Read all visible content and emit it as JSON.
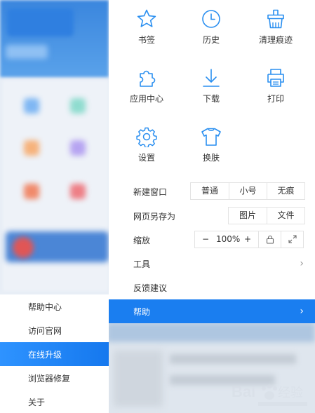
{
  "menu": {
    "icons": [
      {
        "label": "书签",
        "icon": "star-icon"
      },
      {
        "label": "历史",
        "icon": "clock-icon"
      },
      {
        "label": "清理痕迹",
        "icon": "broom-icon"
      },
      {
        "label": "应用中心",
        "icon": "puzzle-icon"
      },
      {
        "label": "下载",
        "icon": "download-icon"
      },
      {
        "label": "打印",
        "icon": "printer-icon"
      },
      {
        "label": "设置",
        "icon": "gear-icon"
      },
      {
        "label": "换肤",
        "icon": "tshirt-icon"
      }
    ],
    "new_window": {
      "label": "新建窗口",
      "options": [
        "普通",
        "小号",
        "无痕"
      ]
    },
    "save_as": {
      "label": "网页另存为",
      "options": [
        "图片",
        "文件"
      ]
    },
    "zoom": {
      "label": "缩放",
      "minus": "−",
      "value": "100%",
      "plus": "+"
    },
    "tools": {
      "label": "工具"
    },
    "feedback": {
      "label": "反馈建议"
    },
    "help": {
      "label": "帮助"
    },
    "chevron": "›"
  },
  "submenu": {
    "items": [
      "帮助中心",
      "访问官网",
      "在线升级",
      "浏览器修复",
      "关于"
    ],
    "active_index": 2
  },
  "colors": {
    "accent": "#1a7ef0",
    "icon": "#2a8ff0"
  }
}
